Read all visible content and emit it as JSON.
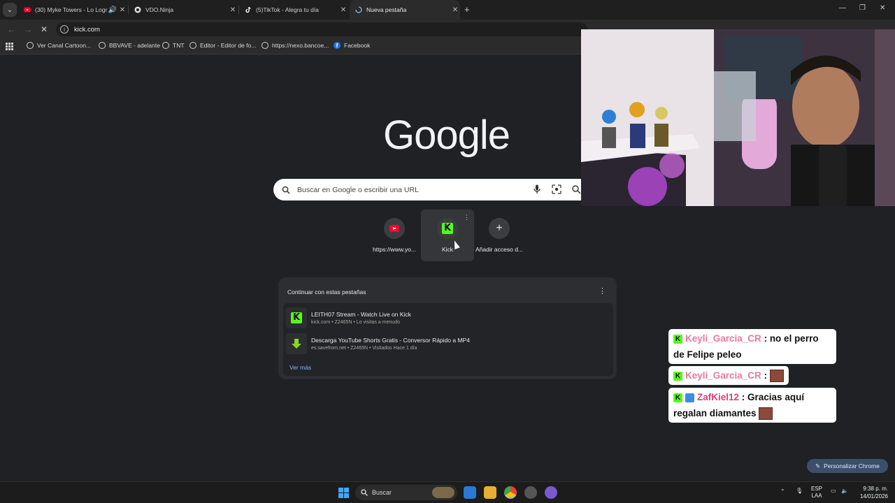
{
  "browser": {
    "tabs": [
      {
        "title": "(30) Myke Towers - Lo Logr",
        "icon": "youtube-icon",
        "audio": true
      },
      {
        "title": "VDO.Ninja",
        "icon": "vdoninja-icon"
      },
      {
        "title": "(5)TikTok - Alegra tu día",
        "icon": "tiktok-icon"
      },
      {
        "title": "Nueva pestaña",
        "icon": "loading-icon",
        "active": true
      }
    ],
    "url": "kick.com",
    "bookmarks": [
      "Ver Canal Cartoon...",
      "BBVAVE - adelante",
      "TNT",
      "Editor - Editor de fo...",
      "https://nexo.bancoe...",
      "Facebook"
    ]
  },
  "ntp": {
    "logo": "Google",
    "search_placeholder": "Buscar en Google o escribir una URL",
    "shortcuts": [
      "https://www.yo...",
      "Kick",
      "Añadir acceso d..."
    ],
    "continue_title": "Continuar con estas pestañas",
    "items": [
      {
        "title": "LEITH07 Stream - Watch Live on Kick",
        "meta": "kick.com • Z2465N • Lo visitas a menudo"
      },
      {
        "title": "Descarga YouTube Shorts Gratis - Conversor Rápido a MP4",
        "meta": "es.savefrom.net • Z2465N • Visitados Hace 1 día"
      }
    ],
    "ver_mas": "Ver más",
    "customize": "Personalizar Chrome"
  },
  "chat": [
    {
      "user": "Keyli_Garcia_CR",
      "sep": " : ",
      "msg": "no el perro de Felipe peleo"
    },
    {
      "user": "Keyli_Garcia_CR",
      "sep": " : ",
      "msg": ""
    },
    {
      "user": "ZafKiel12",
      "sep": " : ",
      "msg": "Gracias aquí regalan diamantes"
    }
  ],
  "taskbar": {
    "search": "Buscar",
    "lang1": "ESP",
    "lang2": "LAA",
    "time": "9:38 p. m.",
    "date": "14/01/2026"
  }
}
